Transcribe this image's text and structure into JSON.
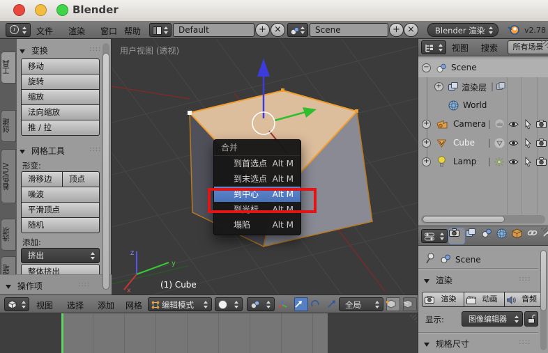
{
  "titlebar": {
    "title": "Blender"
  },
  "menubar": {
    "menus": [
      "文件",
      "渲染",
      "窗口",
      "帮助"
    ],
    "layout_value": "Default",
    "scene_value": "Scene",
    "engine_value": "Blender 渲染",
    "version": "v2.78"
  },
  "glyphs": {
    "info": "i",
    "plus": "+",
    "close": "×",
    "grip": "::::",
    "pipe": "|",
    "expand": "+",
    "collapsed": "−"
  },
  "toolshelf": {
    "tabs": [
      "工具",
      "创建",
      "着色/UV",
      "选项",
      "蜡笔"
    ],
    "transform": {
      "title": "变换",
      "buttons": [
        "移动",
        "旋转",
        "缩放",
        "法向缩放",
        "推 / 拉"
      ]
    },
    "meshtools": {
      "title": "网格工具",
      "deform_label": "形变:",
      "deform_pair": [
        "滑移边",
        "顶点"
      ],
      "deform_buttons": [
        "噪波",
        "平滑顶点",
        "随机"
      ],
      "add_label": "添加:",
      "extrude_value": "挤出",
      "extrude_all": "整体挤出"
    },
    "operator": {
      "title": "操作项"
    }
  },
  "viewport": {
    "view_label": "用户视图 (透视)",
    "object_info": "(1) Cube",
    "axis_labels": {
      "x": "x",
      "y": "y",
      "z": "z"
    },
    "merge_menu": {
      "title": "合并",
      "highlighted_index": 2,
      "items": [
        {
          "label": "到首选点",
          "shortcut": "Alt M"
        },
        {
          "label": "到末选点",
          "shortcut": "Alt M"
        },
        {
          "label": "到中心",
          "shortcut": "Alt M"
        },
        {
          "label": "到光标",
          "shortcut": "Alt M"
        },
        {
          "label": "塌陷",
          "shortcut": "Alt M"
        }
      ]
    }
  },
  "viewport_header": {
    "menus": [
      "视图",
      "选择",
      "添加",
      "网格"
    ],
    "mode_value": "编辑模式",
    "orientation_value": "全局"
  },
  "outliner": {
    "menus": [
      "视图",
      "搜索"
    ],
    "scope_value": "所有场景",
    "rows": [
      {
        "label": "Scene"
      },
      {
        "label": "渲染层"
      },
      {
        "label": "World"
      },
      {
        "label": "Camera"
      },
      {
        "label": "Cube"
      },
      {
        "label": "Lamp"
      }
    ]
  },
  "properties": {
    "breadcrumb": "Scene",
    "render": {
      "title": "渲染",
      "buttons": [
        "渲染",
        "动画",
        "音频"
      ],
      "display_label": "显示:",
      "display_value": "图像编辑器"
    },
    "dimensions": {
      "title": "规格尺寸"
    }
  },
  "colors": {
    "selection_blue": "#5b84c8",
    "annotation_red": "#e21414",
    "selected_edge_orange": "#f09f2f",
    "timeline_marker_green": "#5fd35f"
  }
}
